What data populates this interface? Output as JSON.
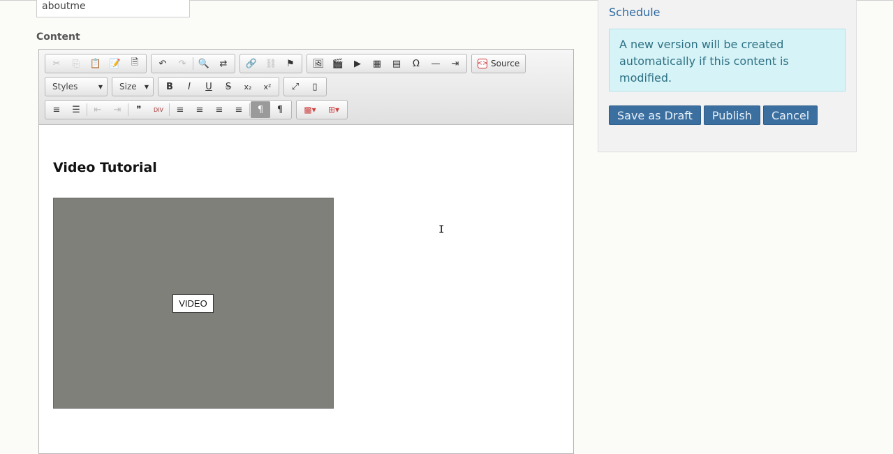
{
  "form": {
    "slug_value": "aboutme",
    "content_label": "Content"
  },
  "editor": {
    "toolbar": {
      "row1": {
        "clipboard": [
          {
            "name": "cut-icon",
            "glyph": "✂",
            "disabled": true
          },
          {
            "name": "copy-icon",
            "glyph": "⎘",
            "disabled": true
          },
          {
            "name": "paste-icon",
            "glyph": "📋",
            "disabled": false
          },
          {
            "name": "paste-text-icon",
            "glyph": "📝",
            "disabled": false
          },
          {
            "name": "paste-word-icon",
            "glyph": "🗎",
            "disabled": false
          }
        ],
        "history": [
          {
            "name": "undo-icon",
            "glyph": "↶",
            "disabled": false
          },
          {
            "name": "redo-icon",
            "glyph": "↷",
            "disabled": true
          },
          {
            "name": "find-icon",
            "glyph": "🔍",
            "disabled": false
          },
          {
            "name": "replace-icon",
            "glyph": "⇄",
            "disabled": false
          }
        ],
        "links": [
          {
            "name": "link-icon",
            "glyph": "🔗",
            "disabled": false
          },
          {
            "name": "unlink-icon",
            "glyph": "⛓",
            "disabled": true
          },
          {
            "name": "anchor-icon",
            "glyph": "⚑",
            "disabled": false
          }
        ],
        "insert": [
          {
            "name": "image-icon",
            "glyph": "🖼",
            "disabled": false
          },
          {
            "name": "video-icon",
            "glyph": "🎬",
            "disabled": false
          },
          {
            "name": "youtube-icon",
            "glyph": "▶",
            "disabled": false
          },
          {
            "name": "table-icon",
            "glyph": "▦",
            "disabled": false
          },
          {
            "name": "iframe-icon",
            "glyph": "▤",
            "disabled": false
          },
          {
            "name": "special-char-icon",
            "glyph": "Ω",
            "disabled": false
          },
          {
            "name": "horizontal-rule-icon",
            "glyph": "—",
            "disabled": false
          },
          {
            "name": "page-break-icon",
            "glyph": "⇥",
            "disabled": false
          }
        ],
        "source_label": "Source"
      },
      "row2": {
        "styles_label": "Styles",
        "size_label": "Size",
        "basic": [
          {
            "name": "bold-icon",
            "glyph": "B",
            "disabled": false
          },
          {
            "name": "italic-icon",
            "glyph": "I",
            "disabled": false
          },
          {
            "name": "underline-icon",
            "glyph": "U",
            "disabled": false
          },
          {
            "name": "strikethrough-icon",
            "glyph": "S",
            "disabled": false
          },
          {
            "name": "subscript-icon",
            "glyph": "x₂",
            "disabled": false
          },
          {
            "name": "superscript-icon",
            "glyph": "x²",
            "disabled": false
          }
        ],
        "tools": [
          {
            "name": "maximize-icon",
            "glyph": "⤢",
            "disabled": false
          },
          {
            "name": "show-blocks-icon",
            "glyph": "▯",
            "disabled": false
          }
        ]
      },
      "row3": {
        "paragraph": [
          {
            "name": "numbered-list-icon",
            "glyph": "≡",
            "disabled": false
          },
          {
            "name": "bulleted-list-icon",
            "glyph": "☰",
            "disabled": false
          },
          {
            "name": "outdent-icon",
            "glyph": "⇤",
            "disabled": true
          },
          {
            "name": "indent-icon",
            "glyph": "⇥",
            "disabled": true
          },
          {
            "name": "blockquote-icon",
            "glyph": "❞",
            "disabled": false
          },
          {
            "name": "div-icon",
            "glyph": "DIV",
            "disabled": false
          },
          {
            "name": "align-left-icon",
            "glyph": "≡",
            "disabled": false
          },
          {
            "name": "align-center-icon",
            "glyph": "≡",
            "disabled": false
          },
          {
            "name": "align-right-icon",
            "glyph": "≡",
            "disabled": false
          },
          {
            "name": "justify-icon",
            "glyph": "≡",
            "disabled": false
          },
          {
            "name": "ltr-icon",
            "glyph": "¶",
            "disabled": false,
            "active": true
          },
          {
            "name": "rtl-icon",
            "glyph": "¶",
            "disabled": false
          }
        ],
        "extras": [
          {
            "name": "text-color-icon",
            "glyph": "▩▾",
            "disabled": false
          },
          {
            "name": "table-menu-icon",
            "glyph": "⊞▾",
            "disabled": false
          }
        ]
      }
    },
    "body": {
      "heading": "Video Tutorial",
      "video_label": "VIDEO"
    }
  },
  "sidebar": {
    "schedule_link": "Schedule",
    "notice": "A new version will be created automatically if this content is modified.",
    "notice_color": "#d6f3f7",
    "buttons": {
      "save_draft": "Save as Draft",
      "publish": "Publish",
      "cancel": "Cancel"
    },
    "button_color": "#3b6fa0"
  }
}
